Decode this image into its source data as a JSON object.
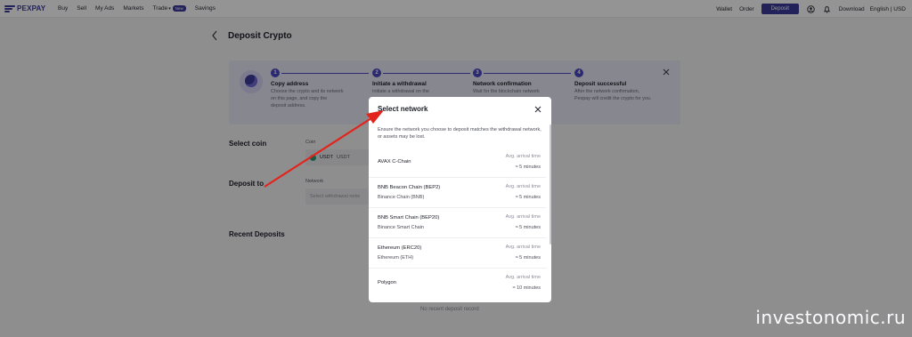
{
  "nav": {
    "logo": "PEXPAY",
    "links": [
      "Buy",
      "Sell",
      "My Ads",
      "Markets"
    ],
    "trade_label": "Trade",
    "trade_badge": "New",
    "savings_label": "Savings",
    "wallet_label": "Wallet",
    "order_label": "Order",
    "deposit_label": "Deposit",
    "download_label": "Download",
    "lang_currency_label": "English | USD"
  },
  "page": {
    "title": "Deposit Crypto"
  },
  "steps": [
    {
      "num": "1",
      "title": "Copy address",
      "desc": "Choose the crypto and its network on this page, and copy the deposit address."
    },
    {
      "num": "2",
      "title": "Initiate a withdrawal",
      "desc": "Initiate a withdrawal on the"
    },
    {
      "num": "3",
      "title": "Network confirmation",
      "desc": "Wait for the blockchain network"
    },
    {
      "num": "4",
      "title": "Deposit successful",
      "desc": "After the network confirmation, Pexpay will credit the crypto for you."
    }
  ],
  "form": {
    "select_coin_label": "Select coin",
    "coin_field_label": "Coin",
    "coin_value": "USDT",
    "coin_value_sub": "USDT",
    "deposit_to_label": "Deposit to",
    "network_field_label": "Network",
    "network_placeholder": "Select withdrawal netw",
    "recent_deposits_label": "Recent Deposits",
    "empty_text": "No recent deposit record"
  },
  "modal": {
    "title": "Select network",
    "desc": "Ensure the network you choose to deposit matches the withdrawal network, or assets may be lost.",
    "networks": [
      {
        "name": "AVAX C-Chain",
        "sub": "",
        "arrival_label": "Avg. arrival time",
        "arrival": "≈ 5 minutes"
      },
      {
        "name": "BNB Beacon Chain (BEP2)",
        "sub": "Binance Chain (BNB)",
        "arrival_label": "Avg. arrival time",
        "arrival": "≈ 5 minutes"
      },
      {
        "name": "BNB Smart Chain (BEP20)",
        "sub": "Binance Smart Chain",
        "arrival_label": "Avg. arrival time",
        "arrival": "≈ 5 minutes"
      },
      {
        "name": "Ethereum (ERC20)",
        "sub": "Ethereum (ETH)",
        "arrival_label": "Avg. arrival time",
        "arrival": "≈ 5 minutes"
      },
      {
        "name": "Polygon",
        "sub": "",
        "arrival_label": "Avg. arrival time",
        "arrival": "≈ 10 minutes"
      }
    ]
  },
  "watermark": "investonomic.ru",
  "colors": {
    "brand": "#3b3a9a",
    "annotation_arrow": "#e3241c"
  }
}
